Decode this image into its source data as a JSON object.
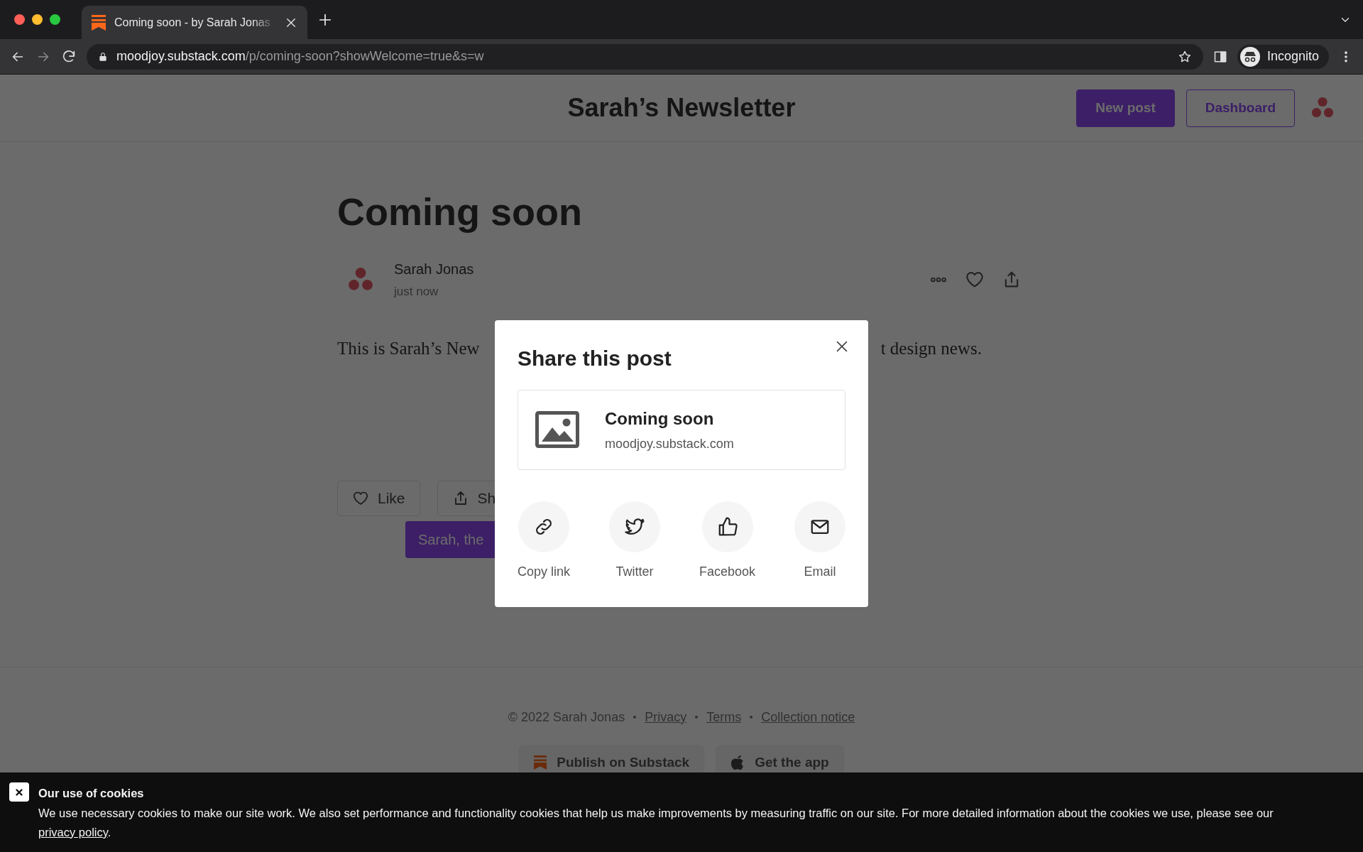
{
  "browser": {
    "tab": {
      "title": "Coming soon - by Sarah Jonas"
    },
    "url": {
      "host": "moodjoy.substack.com",
      "path": "/p/coming-soon?showWelcome=true&s=w"
    },
    "profile": "Incognito"
  },
  "header": {
    "title": "Sarah’s Newsletter",
    "buttons": [
      {
        "label": "New post",
        "kind": "primary"
      },
      {
        "label": "Dashboard",
        "kind": "outline"
      }
    ]
  },
  "post": {
    "title": "Coming soon",
    "author": "Sarah Jonas",
    "time": "just now",
    "body_fragments": [
      "This is Sarah’s New",
      "t design news."
    ],
    "actions": [
      {
        "label": "Like",
        "kind": "like"
      },
      {
        "label": "Sh",
        "kind": "share"
      }
    ],
    "tooltip": "Sarah, the"
  },
  "footer": {
    "copyright": "© 2022 Sarah Jonas",
    "links": [
      "Privacy",
      "Terms",
      "Collection notice"
    ],
    "buttons": [
      {
        "label": "Publish on Substack",
        "kind": "substack"
      },
      {
        "label": "Get the app",
        "kind": "apple"
      }
    ]
  },
  "share_dialog": {
    "title": "Share this post",
    "preview": {
      "title": "Coming soon",
      "domain": "moodjoy.substack.com"
    },
    "options": [
      {
        "label": "Copy link",
        "kind": "link"
      },
      {
        "label": "Twitter",
        "kind": "twitter"
      },
      {
        "label": "Facebook",
        "kind": "facebook"
      },
      {
        "label": "Email",
        "kind": "email"
      }
    ]
  },
  "cookie_banner": {
    "title": "Our use of cookies",
    "text": "We use necessary cookies to make our site work. We also set performance and functionality cookies that help us make improvements by measuring traffic on our site. For more detailed information about the cookies we use, please see our ",
    "link": "privacy policy",
    "end": "."
  }
}
